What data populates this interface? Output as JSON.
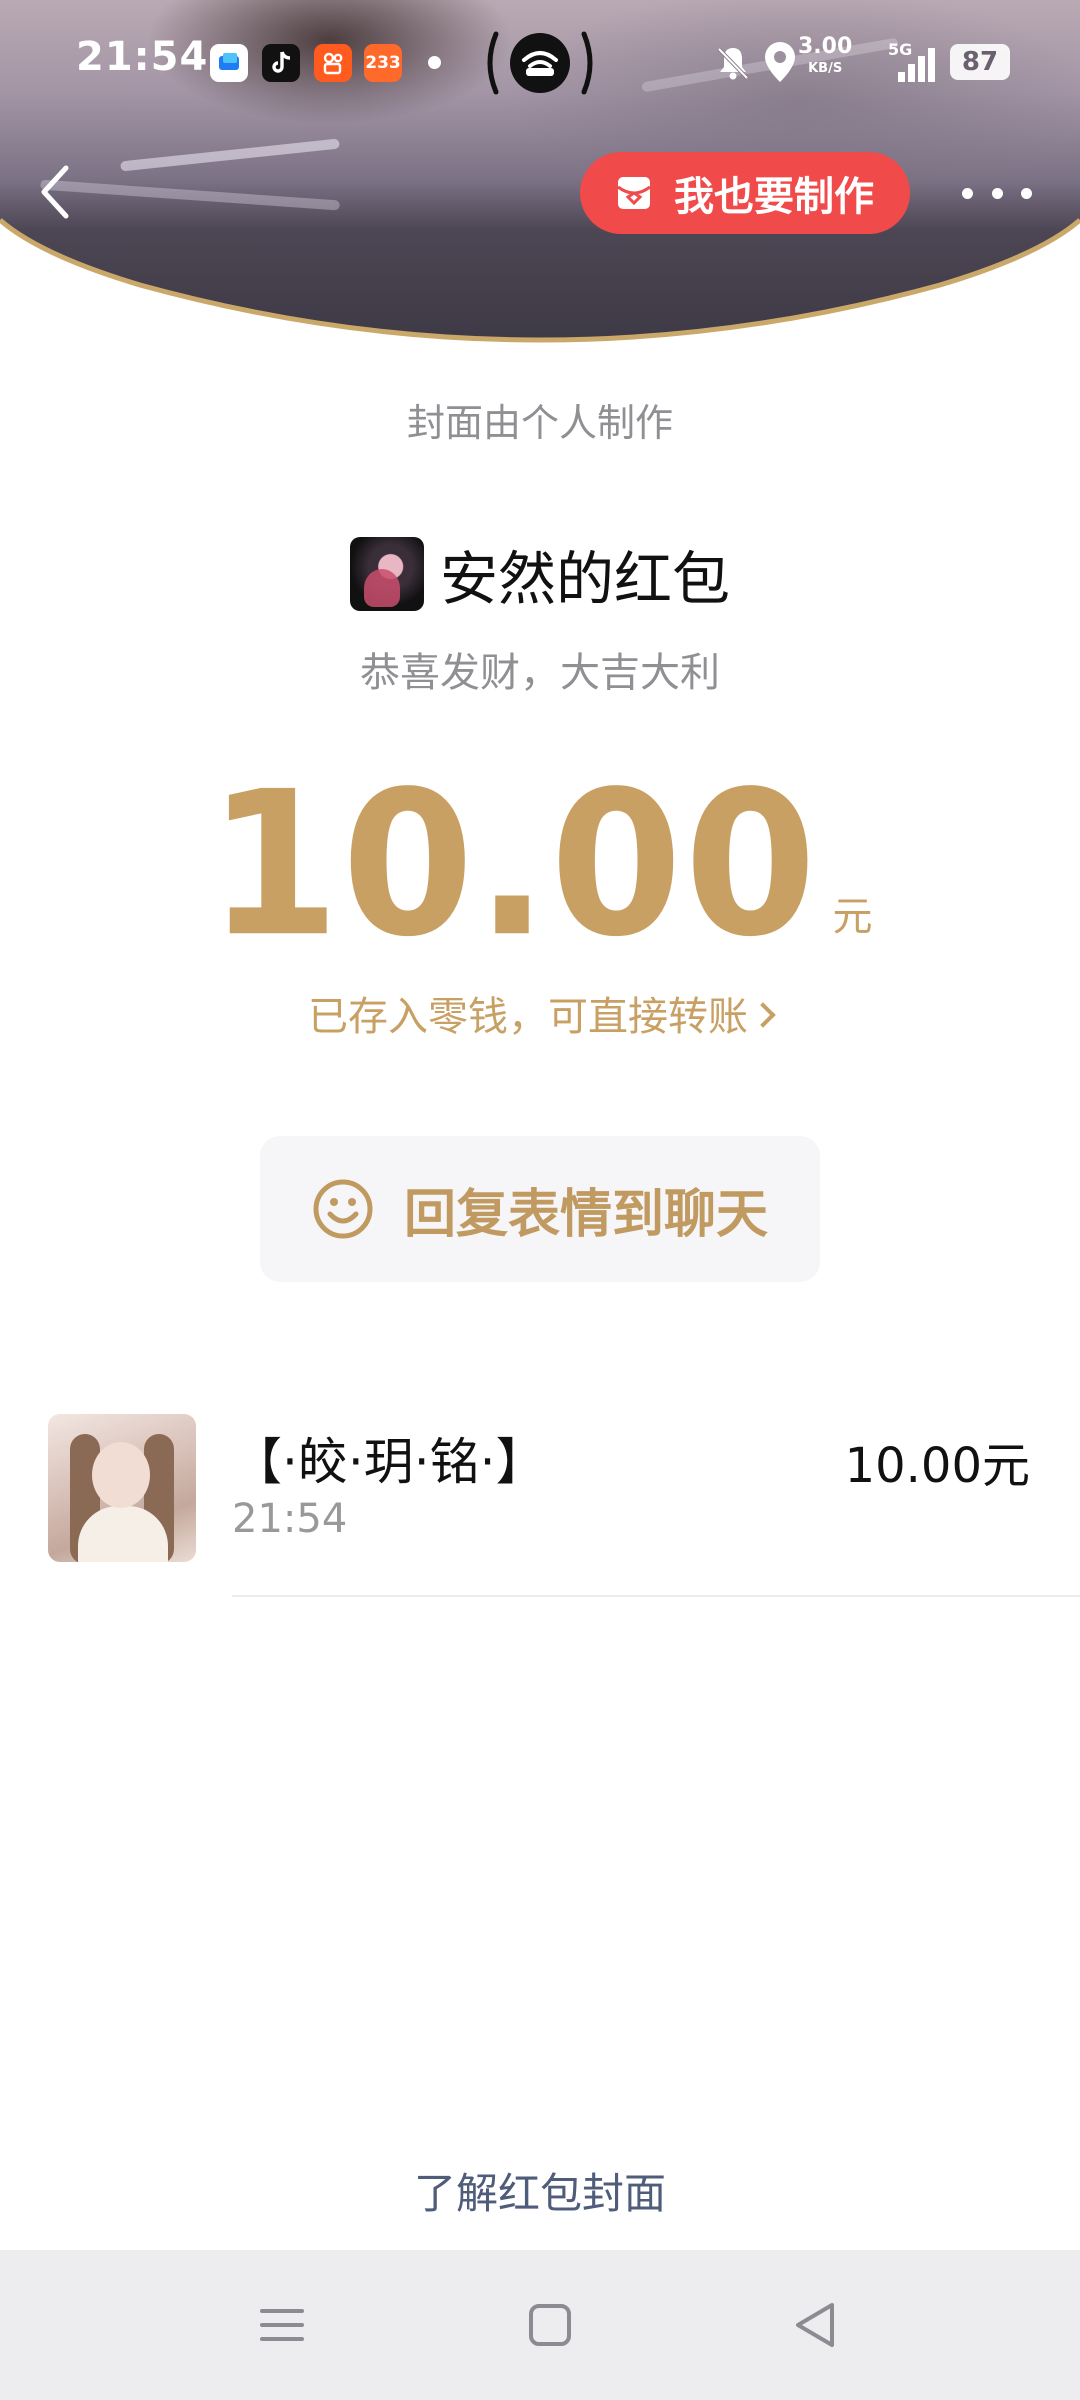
{
  "status_bar": {
    "time": "21:54",
    "app_icons": [
      "feishu-icon",
      "tiktok-icon",
      "kuaishou-icon",
      "bilibili-233-icon"
    ],
    "app_233_label": "233",
    "net_speed_value": "3.00",
    "net_speed_unit": "KB/S",
    "network_label": "5G",
    "battery": "87"
  },
  "header": {
    "make_button_label": "我也要制作"
  },
  "cover_note": "封面由个人制作",
  "packet": {
    "sender_name": "安然的红包",
    "greeting": "恭喜发财，大吉大利",
    "amount": "10.00",
    "amount_unit": "元",
    "saved_text": "已存入零钱，可直接转账",
    "reply_label": "回复表情到聊天"
  },
  "receivers": [
    {
      "name": "【·皎·玥·铭·】",
      "time": "21:54",
      "amount": "10.00元"
    }
  ],
  "footer": {
    "learn_link": "了解红包封面"
  },
  "colors": {
    "gold": "#c9a064",
    "red_button": "#f04a4a",
    "link_blue": "#4f5d7a"
  }
}
